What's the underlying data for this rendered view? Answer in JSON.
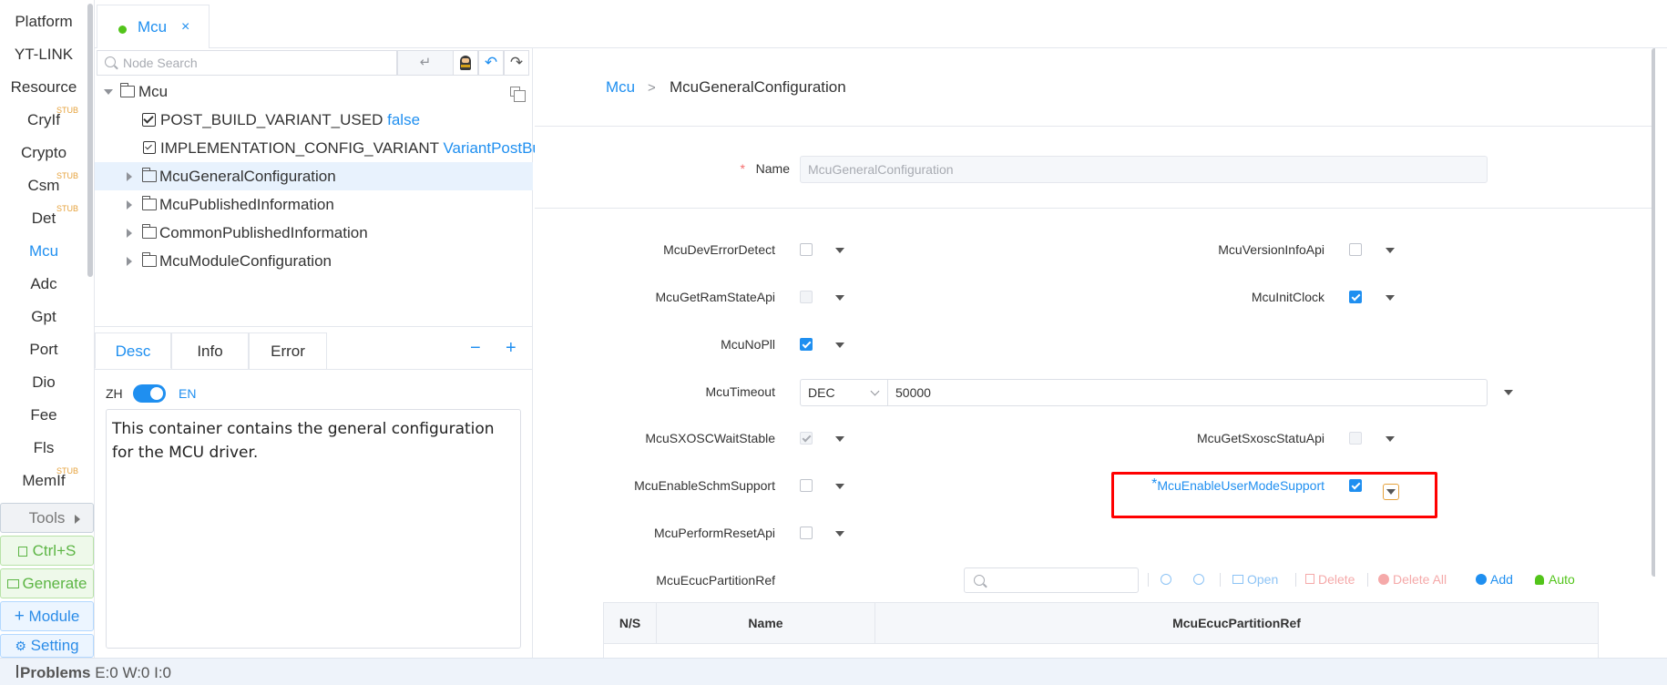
{
  "modules": [
    {
      "label": "Platform",
      "stub": false,
      "active": false
    },
    {
      "label": "YT-LINK",
      "stub": false,
      "active": false
    },
    {
      "label": "Resource",
      "stub": false,
      "active": false
    },
    {
      "label": "CryIf",
      "stub": true,
      "active": false
    },
    {
      "label": "Crypto",
      "stub": false,
      "active": false
    },
    {
      "label": "Csm",
      "stub": true,
      "active": false
    },
    {
      "label": "Det",
      "stub": true,
      "active": false
    },
    {
      "label": "Mcu",
      "stub": false,
      "active": true
    },
    {
      "label": "Adc",
      "stub": false,
      "active": false
    },
    {
      "label": "Gpt",
      "stub": false,
      "active": false
    },
    {
      "label": "Port",
      "stub": false,
      "active": false
    },
    {
      "label": "Dio",
      "stub": false,
      "active": false
    },
    {
      "label": "Fee",
      "stub": false,
      "active": false
    },
    {
      "label": "Fls",
      "stub": false,
      "active": false
    },
    {
      "label": "MemIf",
      "stub": true,
      "active": false
    }
  ],
  "stub_badge": "STUB",
  "tools": {
    "tools_label": "Tools",
    "save_label": "Ctrl+S",
    "generate_label": "Generate",
    "module_label": "Module",
    "setting_label": "Setting"
  },
  "tab": {
    "title": "Mcu",
    "close": "×"
  },
  "tree": {
    "search_placeholder": "Node Search",
    "enter_icon": "↵",
    "root": "Mcu",
    "items": [
      {
        "type": "param-check",
        "label": "POST_BUILD_VARIANT_USED",
        "value": "false"
      },
      {
        "type": "param-enum",
        "label": "IMPLEMENTATION_CONFIG_VARIANT",
        "value": "VariantPostBuild"
      },
      {
        "type": "folder",
        "label": "McuGeneralConfiguration",
        "selected": true
      },
      {
        "type": "folder",
        "label": "McuPublishedInformation"
      },
      {
        "type": "folder",
        "label": "CommonPublishedInformation"
      },
      {
        "type": "folder",
        "label": "McuModuleConfiguration"
      }
    ]
  },
  "desc": {
    "tabs": [
      "Desc",
      "Info",
      "Error"
    ],
    "minus": "−",
    "plus": "+",
    "lang_zh": "ZH",
    "lang_en": "EN",
    "text": "This container contains the general configuration for the MCU driver."
  },
  "main": {
    "breadcrumb": [
      "Mcu",
      "McuGeneralConfiguration"
    ],
    "name_label": "Name",
    "name_value": "McuGeneralConfiguration",
    "fields": {
      "dev_error_detect": "McuDevErrorDetect",
      "version_info_api": "McuVersionInfoApi",
      "get_ram_state_api": "McuGetRamStateApi",
      "init_clock": "McuInitClock",
      "no_pll": "McuNoPll",
      "timeout": "McuTimeout",
      "timeout_format": "DEC",
      "timeout_value": "50000",
      "sxosc_wait_stable": "McuSXOSCWaitStable",
      "get_sxosc_statu_api": "McuGetSxoscStatuApi",
      "enable_schm_support": "McuEnableSchmSupport",
      "enable_user_mode_support": "McuEnableUserModeSupport",
      "perform_reset_api": "McuPerformResetApi",
      "ecuc_partition_ref": "McuEcucPartitionRef"
    },
    "actions": {
      "open": "Open",
      "delete": "Delete",
      "delete_all": "Delete All",
      "add": "Add",
      "auto": "Auto"
    },
    "table_headers": [
      "N/S",
      "Name",
      "McuEcucPartitionRef"
    ]
  },
  "status": {
    "label": "Problems",
    "counts": "E:0 W:0 I:0"
  },
  "colors": {
    "accent": "#1f8ff0",
    "highlight_box": "#ff0000",
    "generate": "#5cb544"
  }
}
